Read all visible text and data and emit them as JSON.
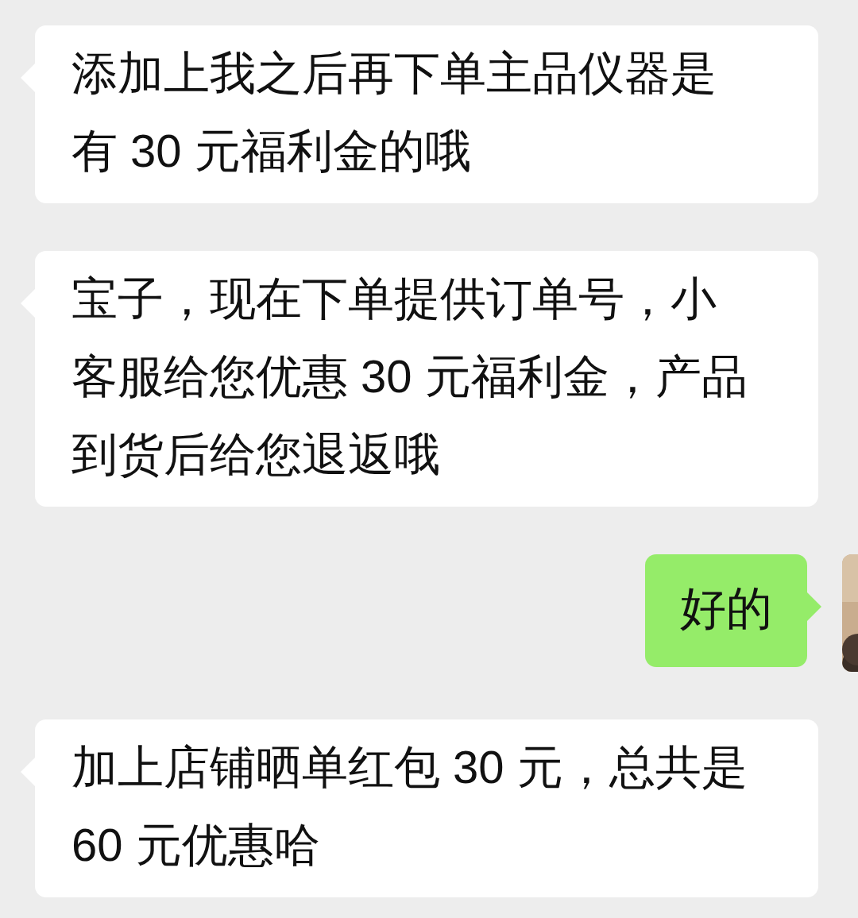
{
  "messages": [
    {
      "kind": "received",
      "lines": [
        "添加上我之后再下单主品仪器是",
        "有 30 元福利金的哦"
      ]
    },
    {
      "kind": "received",
      "lines": [
        "宝子，现在下单提供订单号，小",
        "客服给您优惠 30 元福利金，产品",
        "到货后给您退返哦"
      ]
    },
    {
      "kind": "sent",
      "lines": [
        "好的"
      ],
      "avatar": {
        "kind": "picture"
      }
    },
    {
      "kind": "received",
      "lines": [
        "加上店铺晒单红包 30 元，总共是",
        "60 元优惠哈"
      ]
    }
  ]
}
